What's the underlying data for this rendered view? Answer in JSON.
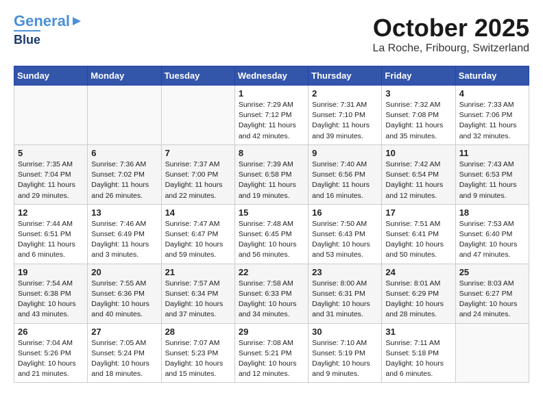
{
  "header": {
    "logo_line1": "General",
    "logo_line2": "Blue",
    "month": "October 2025",
    "location": "La Roche, Fribourg, Switzerland"
  },
  "days_of_week": [
    "Sunday",
    "Monday",
    "Tuesday",
    "Wednesday",
    "Thursday",
    "Friday",
    "Saturday"
  ],
  "weeks": [
    [
      {
        "day": "",
        "info": ""
      },
      {
        "day": "",
        "info": ""
      },
      {
        "day": "",
        "info": ""
      },
      {
        "day": "1",
        "info": "Sunrise: 7:29 AM\nSunset: 7:12 PM\nDaylight: 11 hours and 42 minutes."
      },
      {
        "day": "2",
        "info": "Sunrise: 7:31 AM\nSunset: 7:10 PM\nDaylight: 11 hours and 39 minutes."
      },
      {
        "day": "3",
        "info": "Sunrise: 7:32 AM\nSunset: 7:08 PM\nDaylight: 11 hours and 35 minutes."
      },
      {
        "day": "4",
        "info": "Sunrise: 7:33 AM\nSunset: 7:06 PM\nDaylight: 11 hours and 32 minutes."
      }
    ],
    [
      {
        "day": "5",
        "info": "Sunrise: 7:35 AM\nSunset: 7:04 PM\nDaylight: 11 hours and 29 minutes."
      },
      {
        "day": "6",
        "info": "Sunrise: 7:36 AM\nSunset: 7:02 PM\nDaylight: 11 hours and 26 minutes."
      },
      {
        "day": "7",
        "info": "Sunrise: 7:37 AM\nSunset: 7:00 PM\nDaylight: 11 hours and 22 minutes."
      },
      {
        "day": "8",
        "info": "Sunrise: 7:39 AM\nSunset: 6:58 PM\nDaylight: 11 hours and 19 minutes."
      },
      {
        "day": "9",
        "info": "Sunrise: 7:40 AM\nSunset: 6:56 PM\nDaylight: 11 hours and 16 minutes."
      },
      {
        "day": "10",
        "info": "Sunrise: 7:42 AM\nSunset: 6:54 PM\nDaylight: 11 hours and 12 minutes."
      },
      {
        "day": "11",
        "info": "Sunrise: 7:43 AM\nSunset: 6:53 PM\nDaylight: 11 hours and 9 minutes."
      }
    ],
    [
      {
        "day": "12",
        "info": "Sunrise: 7:44 AM\nSunset: 6:51 PM\nDaylight: 11 hours and 6 minutes."
      },
      {
        "day": "13",
        "info": "Sunrise: 7:46 AM\nSunset: 6:49 PM\nDaylight: 11 hours and 3 minutes."
      },
      {
        "day": "14",
        "info": "Sunrise: 7:47 AM\nSunset: 6:47 PM\nDaylight: 10 hours and 59 minutes."
      },
      {
        "day": "15",
        "info": "Sunrise: 7:48 AM\nSunset: 6:45 PM\nDaylight: 10 hours and 56 minutes."
      },
      {
        "day": "16",
        "info": "Sunrise: 7:50 AM\nSunset: 6:43 PM\nDaylight: 10 hours and 53 minutes."
      },
      {
        "day": "17",
        "info": "Sunrise: 7:51 AM\nSunset: 6:41 PM\nDaylight: 10 hours and 50 minutes."
      },
      {
        "day": "18",
        "info": "Sunrise: 7:53 AM\nSunset: 6:40 PM\nDaylight: 10 hours and 47 minutes."
      }
    ],
    [
      {
        "day": "19",
        "info": "Sunrise: 7:54 AM\nSunset: 6:38 PM\nDaylight: 10 hours and 43 minutes."
      },
      {
        "day": "20",
        "info": "Sunrise: 7:55 AM\nSunset: 6:36 PM\nDaylight: 10 hours and 40 minutes."
      },
      {
        "day": "21",
        "info": "Sunrise: 7:57 AM\nSunset: 6:34 PM\nDaylight: 10 hours and 37 minutes."
      },
      {
        "day": "22",
        "info": "Sunrise: 7:58 AM\nSunset: 6:33 PM\nDaylight: 10 hours and 34 minutes."
      },
      {
        "day": "23",
        "info": "Sunrise: 8:00 AM\nSunset: 6:31 PM\nDaylight: 10 hours and 31 minutes."
      },
      {
        "day": "24",
        "info": "Sunrise: 8:01 AM\nSunset: 6:29 PM\nDaylight: 10 hours and 28 minutes."
      },
      {
        "day": "25",
        "info": "Sunrise: 8:03 AM\nSunset: 6:27 PM\nDaylight: 10 hours and 24 minutes."
      }
    ],
    [
      {
        "day": "26",
        "info": "Sunrise: 7:04 AM\nSunset: 5:26 PM\nDaylight: 10 hours and 21 minutes."
      },
      {
        "day": "27",
        "info": "Sunrise: 7:05 AM\nSunset: 5:24 PM\nDaylight: 10 hours and 18 minutes."
      },
      {
        "day": "28",
        "info": "Sunrise: 7:07 AM\nSunset: 5:23 PM\nDaylight: 10 hours and 15 minutes."
      },
      {
        "day": "29",
        "info": "Sunrise: 7:08 AM\nSunset: 5:21 PM\nDaylight: 10 hours and 12 minutes."
      },
      {
        "day": "30",
        "info": "Sunrise: 7:10 AM\nSunset: 5:19 PM\nDaylight: 10 hours and 9 minutes."
      },
      {
        "day": "31",
        "info": "Sunrise: 7:11 AM\nSunset: 5:18 PM\nDaylight: 10 hours and 6 minutes."
      },
      {
        "day": "",
        "info": ""
      }
    ]
  ]
}
